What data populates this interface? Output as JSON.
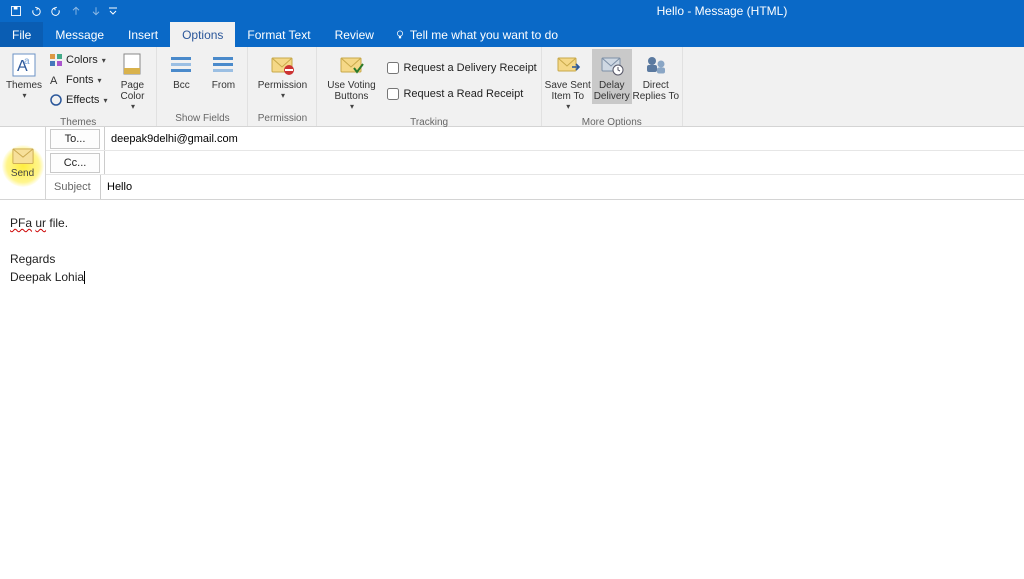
{
  "window": {
    "title": "Hello  -  Message (HTML)"
  },
  "tabs": {
    "file": "File",
    "items": [
      "Message",
      "Insert",
      "Options",
      "Format Text",
      "Review"
    ],
    "active_index": 2,
    "tell_me": "Tell me what you want to do"
  },
  "ribbon": {
    "themes": {
      "themes_btn": "Themes",
      "colors": "Colors",
      "fonts": "Fonts",
      "effects": "Effects",
      "page_color": "Page\nColor",
      "label": "Themes"
    },
    "show_fields": {
      "bcc": "Bcc",
      "from": "From",
      "label": "Show Fields"
    },
    "permission": {
      "permission": "Permission",
      "label": "Permission"
    },
    "tracking": {
      "voting": "Use Voting\nButtons",
      "delivery_receipt": "Request a Delivery Receipt",
      "read_receipt": "Request a Read Receipt",
      "label": "Tracking"
    },
    "more_options": {
      "save_sent": "Save Sent\nItem To",
      "delay": "Delay\nDelivery",
      "direct": "Direct\nReplies To",
      "label": "More Options"
    }
  },
  "address": {
    "send": "Send",
    "to_label": "To...",
    "cc_label": "Cc...",
    "subject_label": "Subject",
    "to_value": "deepak9delhi@gmail.com",
    "cc_value": "",
    "subject_value": "Hello"
  },
  "body": {
    "line1a": "PFa",
    "line1b": "ur",
    "line1c": " file.",
    "line2": "Regards",
    "line3": "Deepak Lohia"
  }
}
